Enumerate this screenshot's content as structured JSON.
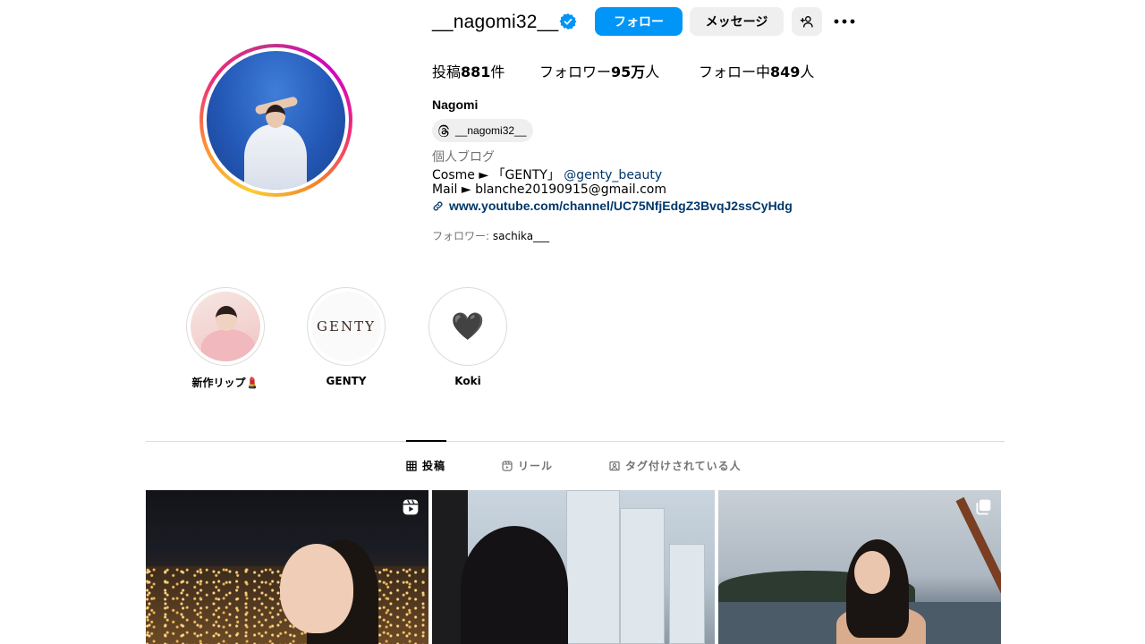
{
  "profile": {
    "username": "__nagomi32__",
    "verified": true,
    "full_name": "Nagomi",
    "threads_handle": "__nagomi32__",
    "category": "個人ブログ",
    "bio_cosme_prefix": "Cosme ► 「GENTY」",
    "bio_cosme_mention": "@genty_beauty",
    "bio_mail": "Mail ► blanche20190915@gmail.com",
    "link": "www.youtube.com/channel/UC75NfjEdgZ3BvqJ2ssCyHdg",
    "followed_by_label": "フォロワー: ",
    "followed_by_user": "sachika___"
  },
  "actions": {
    "follow_label": "フォロー",
    "message_label": "メッセージ"
  },
  "stats": {
    "posts_label": "投稿",
    "posts_value": "881",
    "posts_suffix": "件",
    "followers_label": "フォロワー",
    "followers_value": "95万",
    "followers_suffix": "人",
    "following_label": "フォロー中",
    "following_value": "849",
    "following_suffix": "人"
  },
  "highlights": [
    {
      "label": "新作リップ💄",
      "cover": "portrait-photo"
    },
    {
      "label": "GENTY",
      "cover_text": "GENTY"
    },
    {
      "label": "Koki",
      "cover_emoji": "🖤"
    }
  ],
  "tabs": [
    {
      "label": "投稿",
      "icon": "grid-icon",
      "active": true
    },
    {
      "label": "リール",
      "icon": "reels-icon",
      "active": false
    },
    {
      "label": "タグ付けされている人",
      "icon": "tagged-icon",
      "active": false
    }
  ],
  "posts": [
    {
      "type": "reel",
      "icon": "reel-icon"
    },
    {
      "type": "photo"
    },
    {
      "type": "carousel",
      "icon": "carousel-icon"
    }
  ],
  "colors": {
    "primary_button": "#0095f6",
    "secondary_button": "#efefef",
    "link": "#00376b",
    "muted_text": "#737373",
    "verified_badge": "#0095f6"
  }
}
